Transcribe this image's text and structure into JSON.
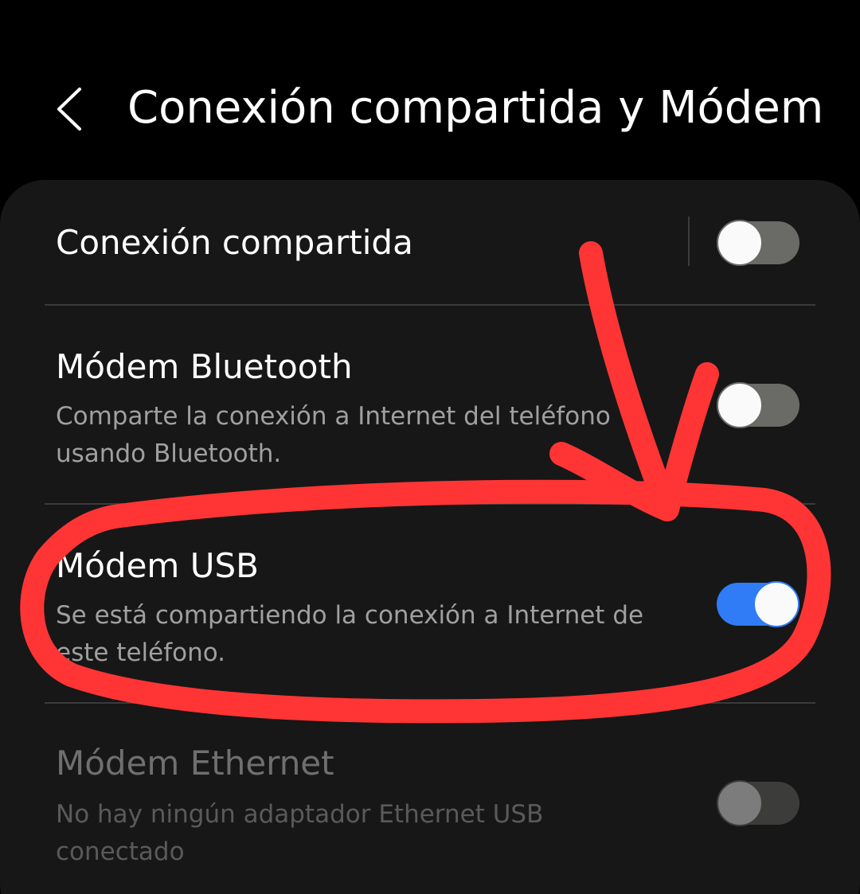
{
  "header": {
    "title": "Conexión compartida y Módem"
  },
  "settings": {
    "rows": [
      {
        "title": "Conexión compartida",
        "subtitle": "",
        "state": "off"
      },
      {
        "title": "Módem Bluetooth",
        "subtitle": "Comparte la conexión a Internet del teléfono usando Bluetooth.",
        "state": "off"
      },
      {
        "title": "Módem USB",
        "subtitle": "Se está compartiendo la conexión a Internet de este teléfono.",
        "state": "on"
      },
      {
        "title": "Módem Ethernet",
        "subtitle": "No hay ningún adaptador Ethernet USB conectado",
        "state": "disabled"
      }
    ]
  },
  "colors": {
    "background": "#000000",
    "card": "#171717",
    "toggle_on": "#2f7cf6",
    "toggle_off": "#6a6a66",
    "annotation": "#ff3535"
  },
  "icons": {
    "back": "chevron-left-icon"
  }
}
